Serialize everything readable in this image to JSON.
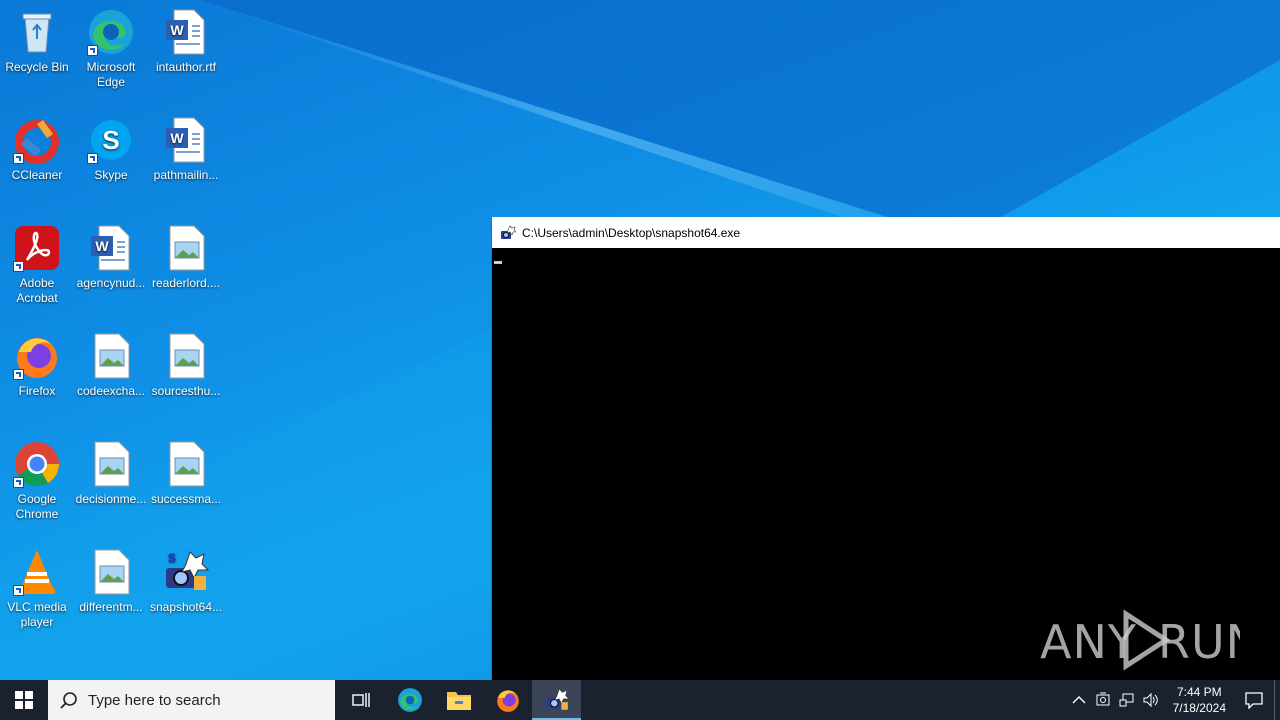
{
  "desktop": {
    "icons": [
      {
        "id": "recycle",
        "label": "Recycle Bin"
      },
      {
        "id": "edge",
        "label": "Microsoft Edge"
      },
      {
        "id": "intauthor",
        "label": "intauthor.rtf"
      },
      {
        "id": "ccleaner",
        "label": "CCleaner"
      },
      {
        "id": "skype",
        "label": "Skype"
      },
      {
        "id": "pathmailin",
        "label": "pathmailin..."
      },
      {
        "id": "acrobat",
        "label": "Adobe Acrobat"
      },
      {
        "id": "agencynud",
        "label": "agencynud..."
      },
      {
        "id": "readerlord",
        "label": "readerlord...."
      },
      {
        "id": "firefox",
        "label": "Firefox"
      },
      {
        "id": "codeexcha",
        "label": "codeexcha..."
      },
      {
        "id": "sourcesthu",
        "label": "sourcesthu..."
      },
      {
        "id": "chrome",
        "label": "Google Chrome"
      },
      {
        "id": "decisionme",
        "label": "decisionme..."
      },
      {
        "id": "successma",
        "label": "successma..."
      },
      {
        "id": "vlc",
        "label": "VLC media player"
      },
      {
        "id": "differentm",
        "label": "differentm..."
      },
      {
        "id": "snapshot64",
        "label": "snapshot64..."
      }
    ]
  },
  "console": {
    "title": "C:\\Users\\admin\\Desktop\\snapshot64.exe"
  },
  "watermark": "ANY RUN",
  "taskbar": {
    "search_placeholder": "Type here to search",
    "time": "7:44 PM",
    "date": "7/18/2024"
  },
  "colors": {
    "desktop_blue": "#0f8fe6",
    "taskbar": "#1a2230",
    "console_bg": "#000000"
  }
}
